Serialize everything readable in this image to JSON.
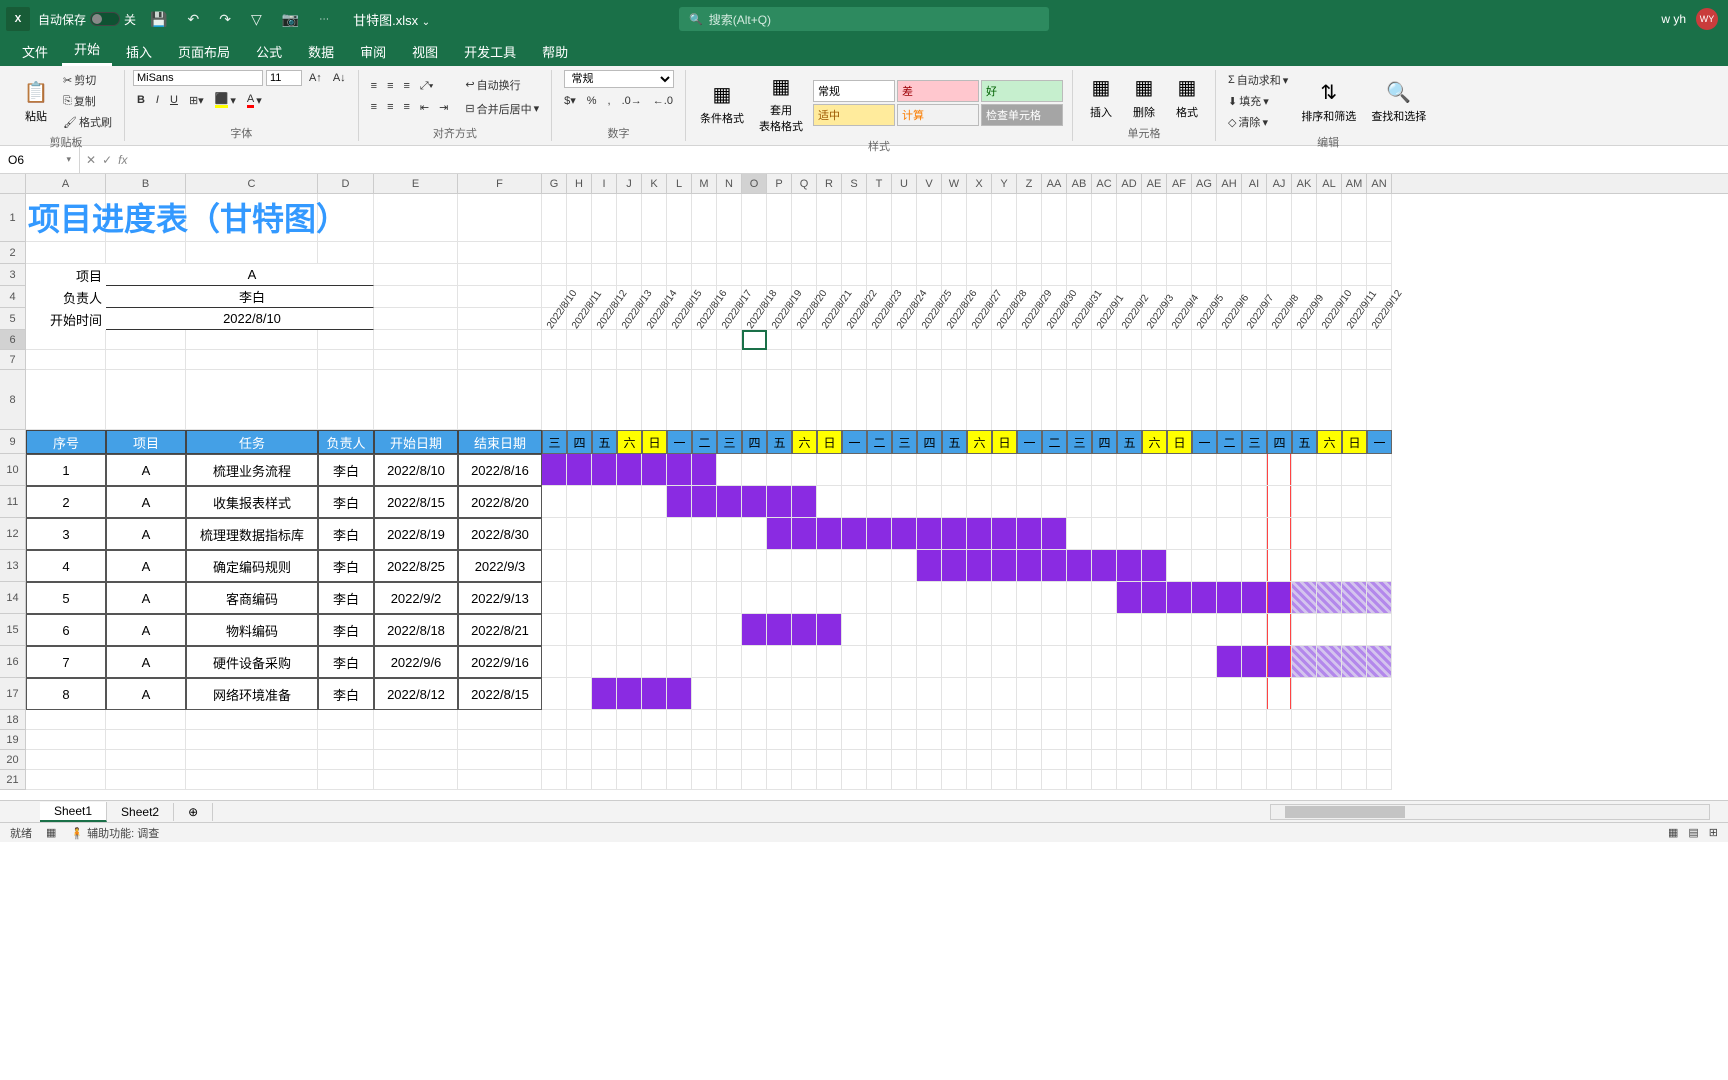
{
  "titlebar": {
    "autosave_label": "自动保存",
    "autosave_state": "关",
    "filename": "甘特图.xlsx",
    "search_placeholder": "搜索(Alt+Q)",
    "user_name": "w yh",
    "user_initials": "WY"
  },
  "tabs": [
    "文件",
    "开始",
    "插入",
    "页面布局",
    "公式",
    "数据",
    "审阅",
    "视图",
    "开发工具",
    "帮助"
  ],
  "active_tab": "开始",
  "ribbon": {
    "clipboard": {
      "label": "剪贴板",
      "paste": "粘贴",
      "cut": "剪切",
      "copy": "复制",
      "format_painter": "格式刷"
    },
    "font": {
      "label": "字体",
      "name": "MiSans",
      "size": "11",
      "bold": "B",
      "italic": "I",
      "underline": "U"
    },
    "align": {
      "label": "对齐方式",
      "wrap": "自动换行",
      "merge": "合并后居中"
    },
    "number": {
      "label": "数字",
      "format": "常规"
    },
    "styles": {
      "label": "样式",
      "cond_fmt": "条件格式",
      "table_fmt": "套用\n表格格式",
      "normal": "常规",
      "bad": "差",
      "good": "好",
      "neutral": "适中",
      "calc": "计算",
      "check": "检查单元格"
    },
    "cells": {
      "label": "单元格",
      "insert": "插入",
      "delete": "删除",
      "format": "格式"
    },
    "editing": {
      "label": "编辑",
      "autosum": "自动求和",
      "fill": "填充",
      "clear": "清除",
      "sort": "排序和筛选",
      "find": "查找和选择"
    }
  },
  "namebox": "O6",
  "formula": "",
  "columns_main": [
    "A",
    "B",
    "C",
    "D",
    "E",
    "F"
  ],
  "columns_day": [
    "G",
    "H",
    "I",
    "J",
    "K",
    "L",
    "M",
    "N",
    "O",
    "P",
    "Q",
    "R",
    "S",
    "T",
    "U",
    "V",
    "W",
    "X",
    "Y",
    "Z",
    "AA",
    "AB",
    "AC",
    "AD",
    "AE",
    "AF",
    "AG",
    "AH",
    "AI",
    "AJ",
    "AK",
    "AL",
    "AM",
    "AN"
  ],
  "title_text": "项目进度表（甘特图）",
  "meta": [
    {
      "label": "项目",
      "value": "A"
    },
    {
      "label": "负责人",
      "value": "李白"
    },
    {
      "label": "开始时间",
      "value": "2022/8/10"
    }
  ],
  "headers": [
    "序号",
    "项目",
    "任务",
    "负责人",
    "开始日期",
    "结束日期"
  ],
  "dates": [
    {
      "d": "2022/8/10",
      "w": "三",
      "wknd": false
    },
    {
      "d": "2022/8/11",
      "w": "四",
      "wknd": false
    },
    {
      "d": "2022/8/12",
      "w": "五",
      "wknd": false
    },
    {
      "d": "2022/8/13",
      "w": "六",
      "wknd": true
    },
    {
      "d": "2022/8/14",
      "w": "日",
      "wknd": true
    },
    {
      "d": "2022/8/15",
      "w": "一",
      "wknd": false
    },
    {
      "d": "2022/8/16",
      "w": "二",
      "wknd": false
    },
    {
      "d": "2022/8/17",
      "w": "三",
      "wknd": false
    },
    {
      "d": "2022/8/18",
      "w": "四",
      "wknd": false
    },
    {
      "d": "2022/8/19",
      "w": "五",
      "wknd": false
    },
    {
      "d": "2022/8/20",
      "w": "六",
      "wknd": true
    },
    {
      "d": "2022/8/21",
      "w": "日",
      "wknd": true
    },
    {
      "d": "2022/8/22",
      "w": "一",
      "wknd": false
    },
    {
      "d": "2022/8/23",
      "w": "二",
      "wknd": false
    },
    {
      "d": "2022/8/24",
      "w": "三",
      "wknd": false
    },
    {
      "d": "2022/8/25",
      "w": "四",
      "wknd": false
    },
    {
      "d": "2022/8/26",
      "w": "五",
      "wknd": false
    },
    {
      "d": "2022/8/27",
      "w": "六",
      "wknd": true
    },
    {
      "d": "2022/8/28",
      "w": "日",
      "wknd": true
    },
    {
      "d": "2022/8/29",
      "w": "一",
      "wknd": false
    },
    {
      "d": "2022/8/30",
      "w": "二",
      "wknd": false
    },
    {
      "d": "2022/8/31",
      "w": "三",
      "wknd": false
    },
    {
      "d": "2022/9/1",
      "w": "四",
      "wknd": false
    },
    {
      "d": "2022/9/2",
      "w": "五",
      "wknd": false
    },
    {
      "d": "2022/9/3",
      "w": "六",
      "wknd": true
    },
    {
      "d": "2022/9/4",
      "w": "日",
      "wknd": true
    },
    {
      "d": "2022/9/5",
      "w": "一",
      "wknd": false
    },
    {
      "d": "2022/9/6",
      "w": "二",
      "wknd": false
    },
    {
      "d": "2022/9/7",
      "w": "三",
      "wknd": false
    },
    {
      "d": "2022/9/8",
      "w": "四",
      "wknd": false
    },
    {
      "d": "2022/9/9",
      "w": "五",
      "wknd": false
    },
    {
      "d": "2022/9/10",
      "w": "六",
      "wknd": true
    },
    {
      "d": "2022/9/11",
      "w": "日",
      "wknd": true
    },
    {
      "d": "2022/9/12",
      "w": "一",
      "wknd": false
    }
  ],
  "tasks": [
    {
      "n": "1",
      "p": "A",
      "t": "梳理业务流程",
      "o": "李白",
      "s": "2022/8/10",
      "e": "2022/8/16",
      "bs": 0,
      "be": 7
    },
    {
      "n": "2",
      "p": "A",
      "t": "收集报表样式",
      "o": "李白",
      "s": "2022/8/15",
      "e": "2022/8/20",
      "bs": 5,
      "be": 11
    },
    {
      "n": "3",
      "p": "A",
      "t": "梳理理数据指标库",
      "o": "李白",
      "s": "2022/8/19",
      "e": "2022/8/30",
      "bs": 9,
      "be": 21
    },
    {
      "n": "4",
      "p": "A",
      "t": "确定编码规则",
      "o": "李白",
      "s": "2022/8/25",
      "e": "2022/9/3",
      "bs": 15,
      "be": 25
    },
    {
      "n": "5",
      "p": "A",
      "t": "客商编码",
      "o": "李白",
      "s": "2022/9/2",
      "e": "2022/9/13",
      "bs": 23,
      "be": 34,
      "hatch_from": 30
    },
    {
      "n": "6",
      "p": "A",
      "t": "物料编码",
      "o": "李白",
      "s": "2022/8/18",
      "e": "2022/8/21",
      "bs": 8,
      "be": 12
    },
    {
      "n": "7",
      "p": "A",
      "t": "硬件设备采购",
      "o": "李白",
      "s": "2022/9/6",
      "e": "2022/9/16",
      "bs": 27,
      "be": 34,
      "hatch_from": 30
    },
    {
      "n": "8",
      "p": "A",
      "t": "网络环境准备",
      "o": "李白",
      "s": "2022/8/12",
      "e": "2022/8/15",
      "bs": 2,
      "be": 6
    }
  ],
  "today_col": 29,
  "sheets": [
    "Sheet1",
    "Sheet2"
  ],
  "active_sheet": "Sheet1",
  "status": {
    "ready": "就绪",
    "acc": "辅助功能: 调查"
  }
}
